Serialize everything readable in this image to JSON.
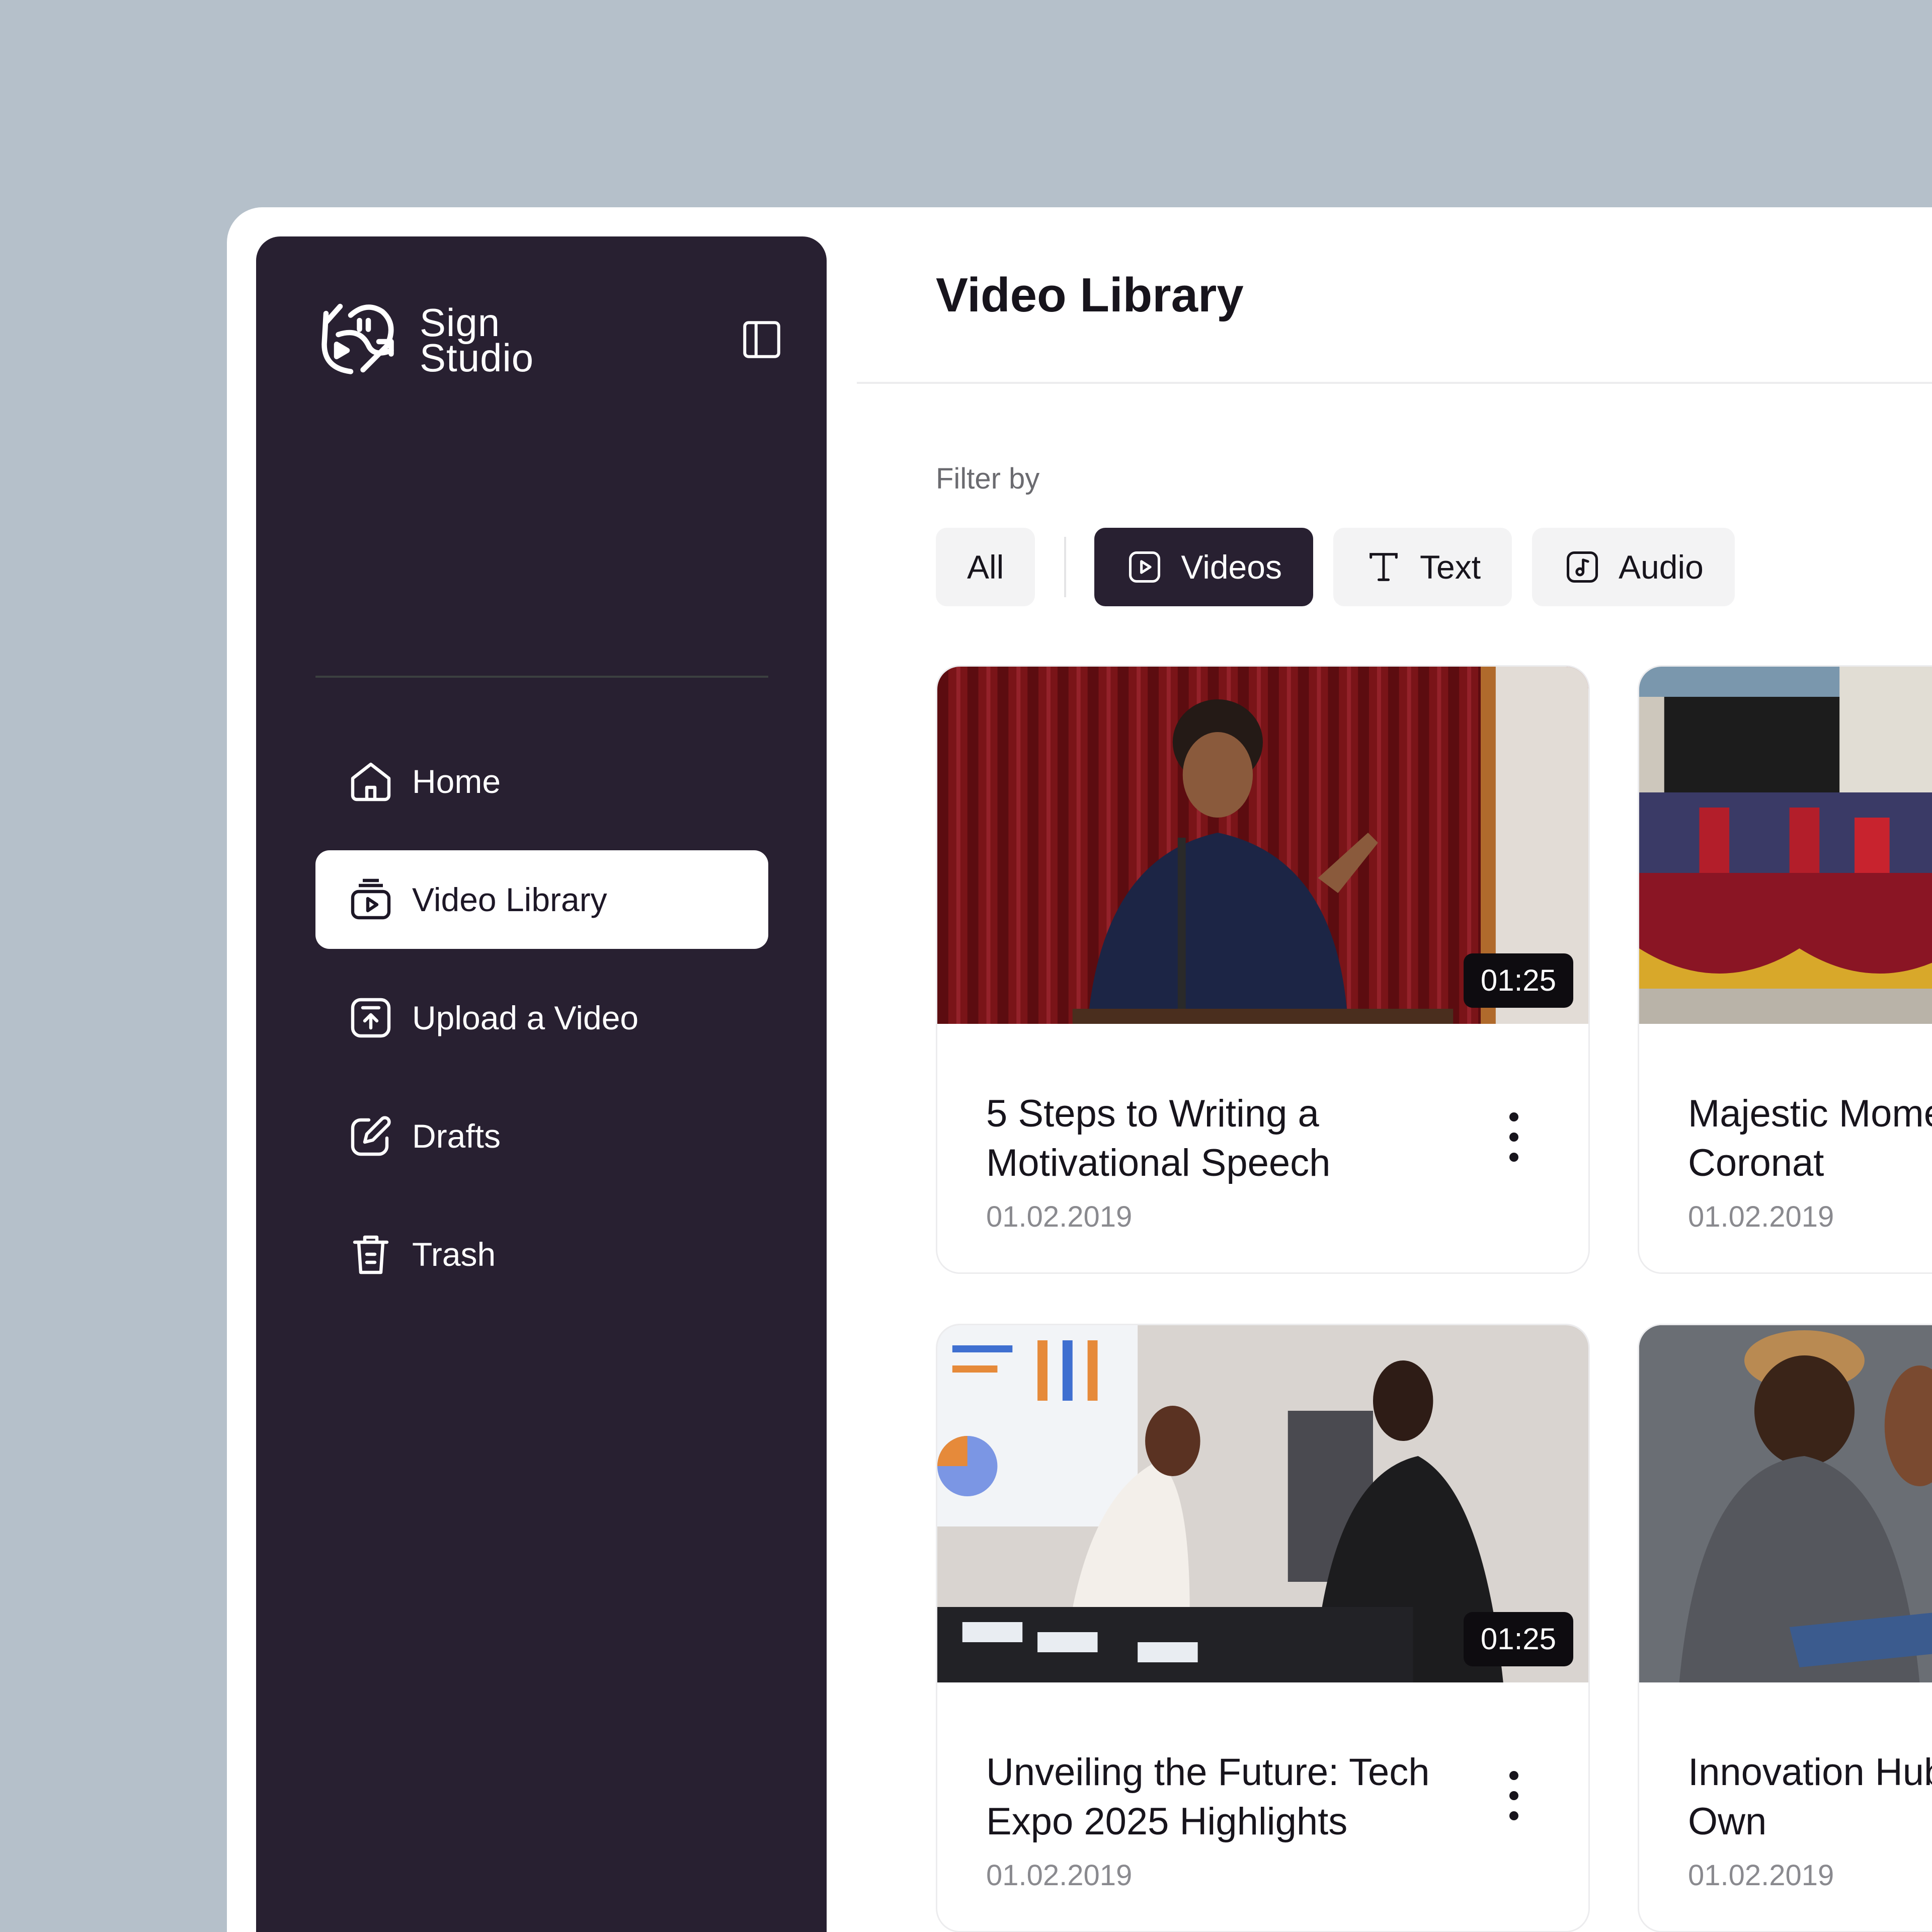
{
  "app": {
    "name": "Sign\nStudio"
  },
  "sidebar": {
    "items": [
      {
        "label": "Home",
        "icon": "home-icon",
        "active": false
      },
      {
        "label": "Video Library",
        "icon": "video-library-icon",
        "active": true
      },
      {
        "label": "Upload a Video",
        "icon": "upload-icon",
        "active": false
      },
      {
        "label": "Drafts",
        "icon": "edit-icon",
        "active": false
      },
      {
        "label": "Trash",
        "icon": "trash-icon",
        "active": false
      }
    ]
  },
  "main": {
    "title": "Video Library",
    "filter_label": "Filter by",
    "filters": [
      {
        "label": "All",
        "active": false
      },
      {
        "label": "Videos",
        "icon": "video-icon",
        "active": true
      },
      {
        "label": "Text",
        "icon": "text-icon",
        "active": false
      },
      {
        "label": "Audio",
        "icon": "audio-icon",
        "active": false
      }
    ],
    "cards": [
      {
        "title": "5 Steps to Writing a Motivational Speech",
        "date": "01.02.2019",
        "duration": "01:25"
      },
      {
        "title": "Majestic Mome King’s Coronat",
        "date": "01.02.2019"
      },
      {
        "title": "Unveiling the Future: Tech Expo 2025 Highlights",
        "date": "01.02.2019",
        "duration": "01:25"
      },
      {
        "title": "Innovation Hub Business Own",
        "date": "01.02.2019"
      }
    ]
  },
  "colors": {
    "sidebar_bg": "#282031",
    "page_bg": "#b5c0ca",
    "active_chip": "#282031"
  }
}
